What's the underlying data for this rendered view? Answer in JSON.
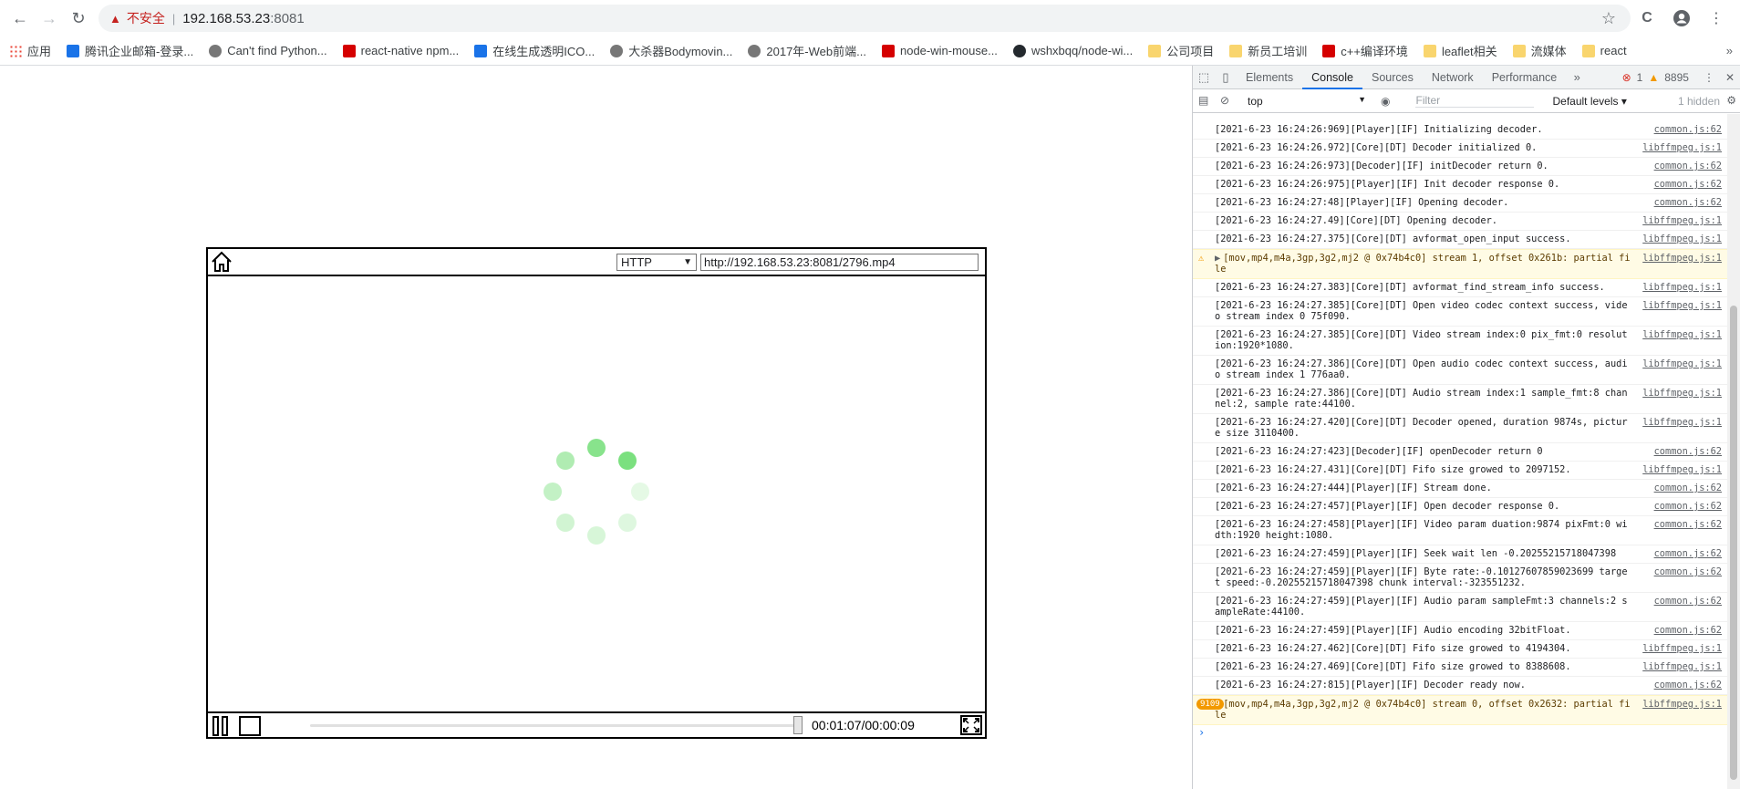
{
  "browser": {
    "security_label": "不安全",
    "url_host": "192.168.53.23",
    "url_port": ":8081"
  },
  "bookmarks": [
    {
      "label": "应用",
      "icon": "apps-icon"
    },
    {
      "label": "腾讯企业邮箱-登录...",
      "icon": "tencent-mail-icon"
    },
    {
      "label": "Can't find Python...",
      "icon": "github-octocat-icon"
    },
    {
      "label": "react-native npm...",
      "icon": "npm-icon"
    },
    {
      "label": "在线生成透明ICO...",
      "icon": "ico-icon"
    },
    {
      "label": "大杀器Bodymovin...",
      "icon": "site-icon"
    },
    {
      "label": "2017年-Web前端...",
      "icon": "site-icon"
    },
    {
      "label": "node-win-mouse...",
      "icon": "npm-icon"
    },
    {
      "label": "wshxbqq/node-wi...",
      "icon": "github-icon"
    },
    {
      "label": "公司项目",
      "icon": "folder-icon"
    },
    {
      "label": "新员工培训",
      "icon": "folder-icon"
    },
    {
      "label": "c++编译环境",
      "icon": "npm-icon"
    },
    {
      "label": "leaflet相关",
      "icon": "folder-icon"
    },
    {
      "label": "流媒体",
      "icon": "folder-icon"
    },
    {
      "label": "react",
      "icon": "folder-icon"
    }
  ],
  "player": {
    "protocol": "HTTP",
    "stream_url": "http://192.168.53.23:8081/2796.mp4",
    "time": "00:01:07/00:00:09",
    "progress_fraction": 1.0
  },
  "devtools": {
    "tabs": [
      "Elements",
      "Console",
      "Sources",
      "Network",
      "Performance"
    ],
    "active_tab": "Console",
    "error_count": "1",
    "warning_count": "8895",
    "context": "top",
    "filter_placeholder": "Filter",
    "levels": "Default levels",
    "hidden": "1 hidden"
  },
  "console_messages": [
    {
      "text": "[2021-6-23 16:24:26:969][Player][IF] Initializing decoder.",
      "src": "common.js:62"
    },
    {
      "text": "[2021-6-23 16:24:26.972][Core][DT] Decoder initialized 0.",
      "src": "libffmpeg.js:1"
    },
    {
      "text": "[2021-6-23 16:24:26:973][Decoder][IF] initDecoder return 0.",
      "src": "common.js:62"
    },
    {
      "text": "[2021-6-23 16:24:26:975][Player][IF] Init decoder response 0.",
      "src": "common.js:62"
    },
    {
      "text": "[2021-6-23 16:24:27:48][Player][IF] Opening decoder.",
      "src": "common.js:62"
    },
    {
      "text": "[2021-6-23 16:24:27.49][Core][DT] Opening decoder.",
      "src": "libffmpeg.js:1"
    },
    {
      "text": "[2021-6-23 16:24:27.375][Core][DT] avformat_open_input success.",
      "src": "libffmpeg.js:1"
    },
    {
      "text": "[mov,mp4,m4a,3gp,3g2,mj2 @ 0x74b4c0] stream 1, offset 0x261b: partial file",
      "src": "libffmpeg.js:1",
      "level": "warn"
    },
    {
      "text": "[2021-6-23 16:24:27.383][Core][DT] avformat_find_stream_info success.",
      "src": "libffmpeg.js:1"
    },
    {
      "text": "[2021-6-23 16:24:27.385][Core][DT] Open video codec context success, video stream index 0 75f090.",
      "src": "libffmpeg.js:1"
    },
    {
      "text": "[2021-6-23 16:24:27.385][Core][DT] Video stream index:0 pix_fmt:0 resolution:1920*1080.",
      "src": "libffmpeg.js:1"
    },
    {
      "text": "[2021-6-23 16:24:27.386][Core][DT] Open audio codec context success, audio stream index 1 776aa0.",
      "src": "libffmpeg.js:1"
    },
    {
      "text": "[2021-6-23 16:24:27.386][Core][DT] Audio stream index:1 sample_fmt:8 channel:2, sample rate:44100.",
      "src": "libffmpeg.js:1"
    },
    {
      "text": "[2021-6-23 16:24:27.420][Core][DT] Decoder opened, duration 9874s, picture size 3110400.",
      "src": "libffmpeg.js:1"
    },
    {
      "text": "[2021-6-23 16:24:27:423][Decoder][IF] openDecoder return 0",
      "src": "common.js:62"
    },
    {
      "text": "[2021-6-23 16:24:27.431][Core][DT] Fifo size growed to 2097152.",
      "src": "libffmpeg.js:1"
    },
    {
      "text": "[2021-6-23 16:24:27:444][Player][IF] Stream done.",
      "src": "common.js:62"
    },
    {
      "text": "[2021-6-23 16:24:27:457][Player][IF] Open decoder response 0.",
      "src": "common.js:62"
    },
    {
      "text": "[2021-6-23 16:24:27:458][Player][IF] Video param duation:9874 pixFmt:0 width:1920 height:1080.",
      "src": "common.js:62"
    },
    {
      "text": "[2021-6-23 16:24:27:459][Player][IF] Seek wait len -0.20255215718047398",
      "src": "common.js:62"
    },
    {
      "text": "[2021-6-23 16:24:27:459][Player][IF] Byte rate:-0.10127607859023699 target speed:-0.20255215718047398 chunk interval:-323551232.",
      "src": "common.js:62"
    },
    {
      "text": "[2021-6-23 16:24:27:459][Player][IF] Audio param sampleFmt:3 channels:2 sampleRate:44100.",
      "src": "common.js:62"
    },
    {
      "text": "[2021-6-23 16:24:27:459][Player][IF] Audio encoding 32bitFloat.",
      "src": "common.js:62"
    },
    {
      "text": "[2021-6-23 16:24:27.462][Core][DT] Fifo size growed to 4194304.",
      "src": "libffmpeg.js:1"
    },
    {
      "text": "[2021-6-23 16:24:27.469][Core][DT] Fifo size growed to 8388608.",
      "src": "libffmpeg.js:1"
    },
    {
      "text": "[2021-6-23 16:24:27:815][Player][IF] Decoder ready now.",
      "src": "common.js:62"
    },
    {
      "text": "[mov,mp4,m4a,3gp,3g2,mj2 @ 0x74b4c0] stream 0, offset 0x2632: partial file",
      "src": "libffmpeg.js:1",
      "level": "warn",
      "count": "9109"
    }
  ],
  "colors": {
    "spinner": "#7be07f",
    "warn": "#f29900",
    "error": "#d93025",
    "insecure": "#c5221f"
  }
}
